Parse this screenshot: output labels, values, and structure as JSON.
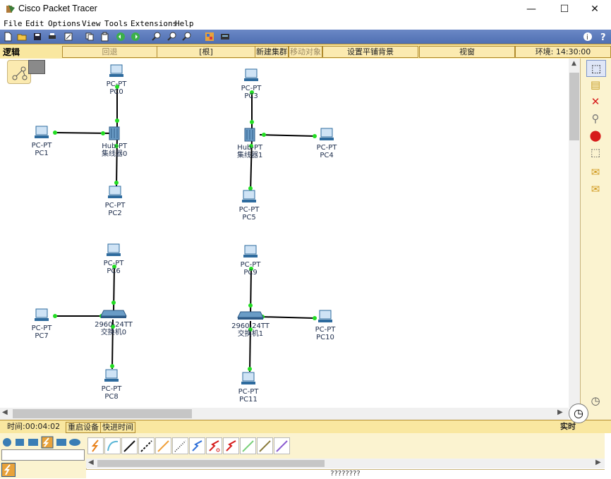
{
  "window": {
    "title": "Cisco Packet Tracer",
    "minimize": "—",
    "maximize": "☐",
    "close": "✕"
  },
  "menu": [
    "File",
    "Edit",
    "Options",
    "View",
    "Tools",
    "Extensions",
    "Help"
  ],
  "workspace_bar": {
    "title": "逻辑",
    "back": "回退",
    "root": "[根]",
    "new_cluster": "新建集群",
    "move_object": "移动对象",
    "set_background": "设置平铺背景",
    "viewport": "视窗",
    "environment": "环境: 14:30:00"
  },
  "devices": [
    {
      "type": "PC-PT",
      "name": "PC0"
    },
    {
      "type": "PC-PT",
      "name": "PC1"
    },
    {
      "type": "PC-PT",
      "name": "PC2"
    },
    {
      "type": "Hub-PT",
      "name": "集线器0"
    },
    {
      "type": "PC-PT",
      "name": "PC3"
    },
    {
      "type": "PC-PT",
      "name": "PC4"
    },
    {
      "type": "PC-PT",
      "name": "PC5"
    },
    {
      "type": "Hub-PT",
      "name": "集线器1"
    },
    {
      "type": "PC-PT",
      "name": "PC6"
    },
    {
      "type": "PC-PT",
      "name": "PC7"
    },
    {
      "type": "PC-PT",
      "name": "PC8"
    },
    {
      "type": "2960-24TT",
      "name": "交换机0"
    },
    {
      "type": "PC-PT",
      "name": "PC9"
    },
    {
      "type": "PC-PT",
      "name": "PC10"
    },
    {
      "type": "PC-PT",
      "name": "PC11"
    },
    {
      "type": "2960-24TT",
      "name": "交换机1"
    }
  ],
  "time_bar": {
    "time": "时间:00:04:02",
    "power_cycle": "重启设备",
    "fast_forward": "快进时间",
    "realtime": "实时"
  },
  "status_line": "????????",
  "colors": {
    "link": "#000000",
    "port_light": "#22dd22",
    "toolbar": "#5a78bc",
    "workspace_bar": "#f9e7a0"
  }
}
